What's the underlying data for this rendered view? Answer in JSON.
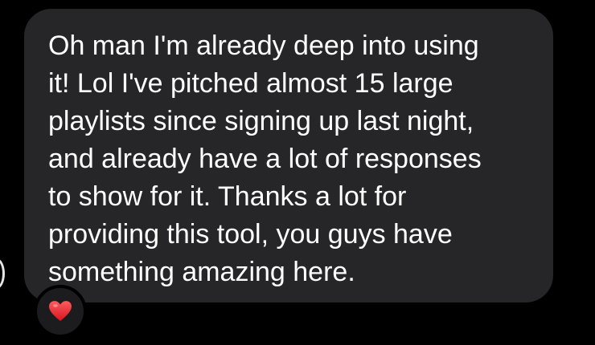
{
  "message": {
    "text": "Oh man I'm already deep into using it! Lol I've pitched almost 15 large playlists since signing up last night, and already have a lot of responses to show for it. Thanks a lot for providing this tool, you guys have something amazing here.",
    "lines": [
      "Oh man I'm already deep into using",
      "it! Lol I've pitched almost 15 large",
      "playlists since signing up last night,",
      "and already have a lot of responses",
      "to show for it. Thanks a lot for",
      "providing this tool, you guys have",
      "something amazing here."
    ]
  },
  "reaction": {
    "icon": "heart-icon",
    "color": "#e8212f"
  },
  "colors": {
    "background": "#000000",
    "bubble": "#262628",
    "text": "#ffffff",
    "reaction_bg": "#1c1c1e"
  }
}
